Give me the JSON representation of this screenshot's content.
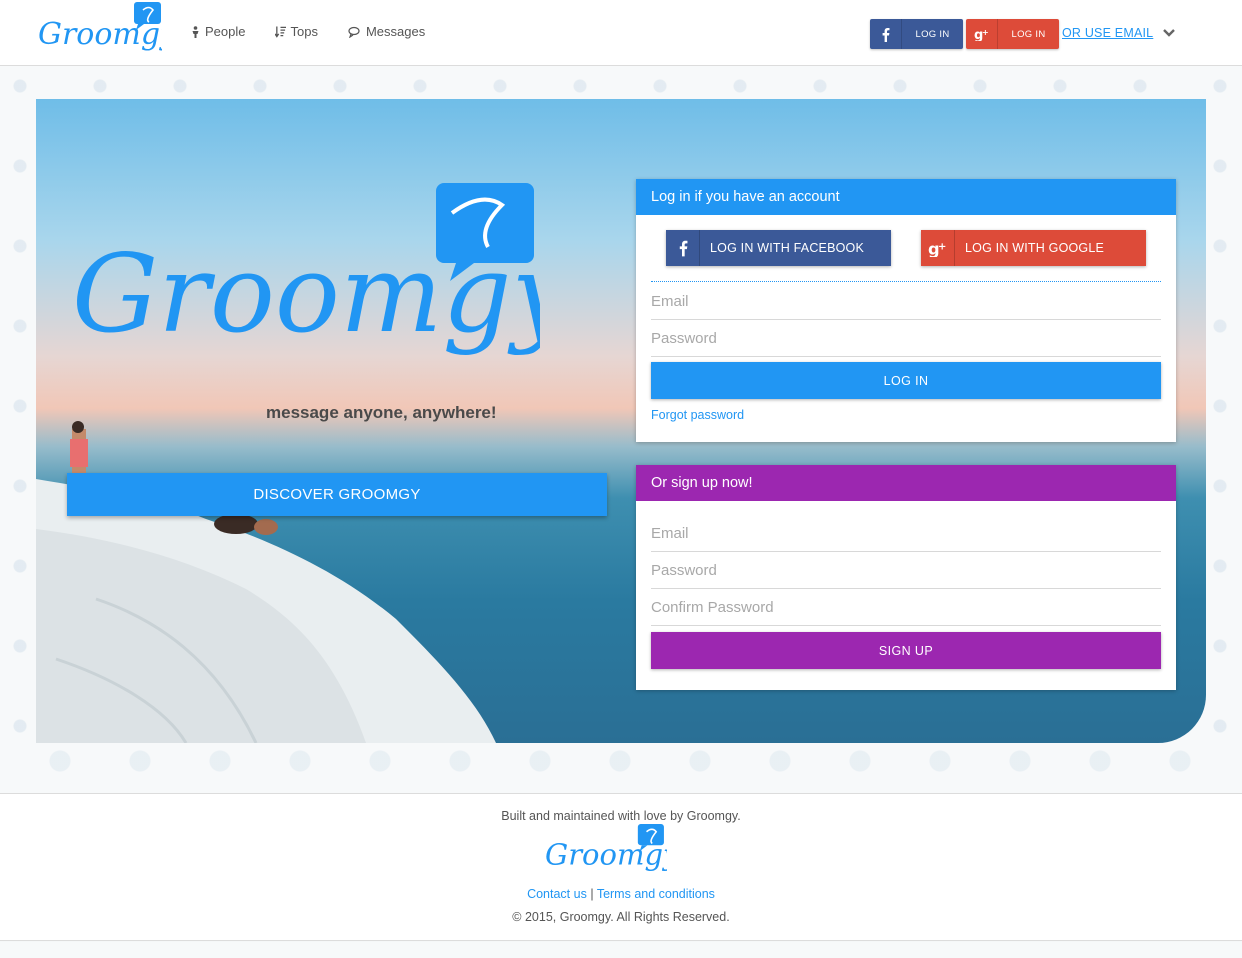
{
  "header": {
    "logo_text": "Groomgy",
    "nav": [
      {
        "label": "People",
        "icon": "person-icon"
      },
      {
        "label": "Tops",
        "icon": "sort-icon"
      },
      {
        "label": "Messages",
        "icon": "chat-icon"
      }
    ],
    "facebook_login_label": "LOG IN",
    "google_login_label": "LOG IN",
    "use_email_label": "OR USE EMAIL"
  },
  "hero": {
    "logo_text": "Groomgy",
    "tagline": "message anyone, anywhere!",
    "discover_label": "DISCOVER GROOMGY"
  },
  "login_card": {
    "title": "Log in if you have an account",
    "facebook_label": "LOG IN WITH FACEBOOK",
    "google_label": "LOG IN WITH GOOGLE",
    "email_placeholder": "Email",
    "password_placeholder": "Password",
    "login_label": "LOG IN",
    "forgot_label": "Forgot password"
  },
  "signup_card": {
    "title": "Or sign up now!",
    "email_placeholder": "Email",
    "password_placeholder": "Password",
    "confirm_placeholder": "Confirm Password",
    "signup_label": "SIGN UP"
  },
  "footer": {
    "built_text": "Built and maintained with love by Groomgy.",
    "logo_text": "Groomgy",
    "contact_label": "Contact us",
    "separator": "|",
    "terms_label": "Terms and conditions",
    "copyright": "© 2015, Groomgy. All Rights Reserved."
  },
  "colors": {
    "primary_blue": "#2196f3",
    "facebook": "#3b5998",
    "google": "#dd4b39",
    "purple": "#9c27b0"
  }
}
